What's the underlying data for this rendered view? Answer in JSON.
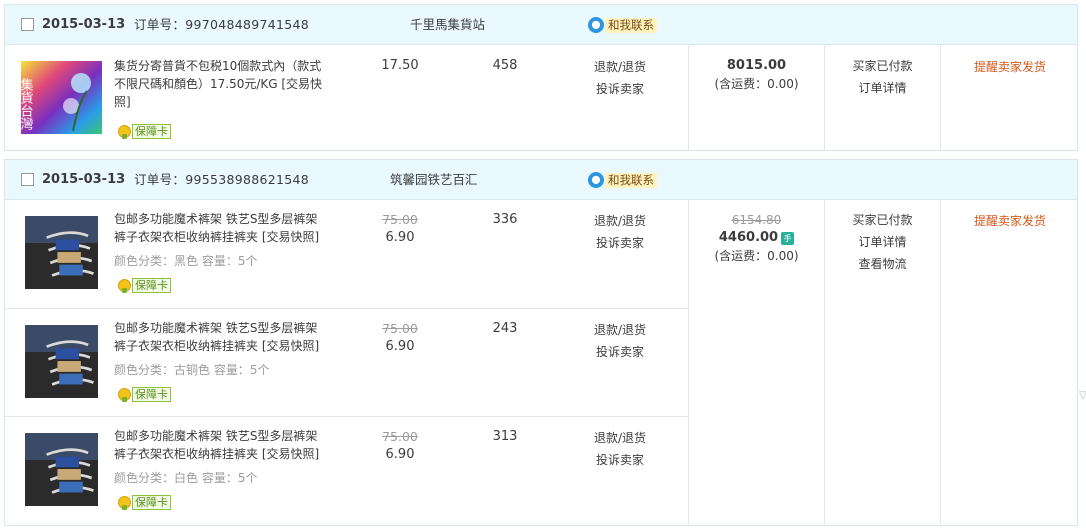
{
  "orders": [
    {
      "date": "2015-03-13",
      "order_no": "订单号：997048489741548",
      "shop": "千里馬集貨站",
      "contact_label": "和我联系",
      "items": [
        {
          "title": "集货分寄普貨不包税10個款式內（款式不限尺碼和顏色）17.50元/KG [交易快照]",
          "thumb_text": "集貨台灣",
          "card_label": "保障卡",
          "price": "17.50",
          "qty": "458",
          "actions": [
            "退款/退货",
            "投诉卖家"
          ]
        }
      ],
      "total": "8015.00",
      "shipping": "(含运费：0.00)",
      "status": [
        "买家已付款",
        "订单详情"
      ],
      "remind": "提醒卖家发货"
    },
    {
      "date": "2015-03-13",
      "order_no": "订单号：995538988621548",
      "shop": "筑馨园铁艺百汇",
      "contact_label": "和我联系",
      "items": [
        {
          "title": "包邮多功能魔术裤架 铁艺S型多层裤架裤子衣架衣柜收纳裤挂裤夹 [交易快照]",
          "sku": "颜色分类：黑色 容量：5个",
          "card_label": "保障卡",
          "orig_price": "75.00",
          "price": "6.90",
          "qty": "336",
          "actions": [
            "退款/退货",
            "投诉卖家"
          ]
        },
        {
          "title": "包邮多功能魔术裤架 铁艺S型多层裤架裤子衣架衣柜收纳裤挂裤夹 [交易快照]",
          "sku": "颜色分类：古铜色 容量：5个",
          "card_label": "保障卡",
          "orig_price": "75.00",
          "price": "6.90",
          "qty": "243",
          "actions": [
            "退款/退货",
            "投诉卖家"
          ]
        },
        {
          "title": "包邮多功能魔术裤架 铁艺S型多层裤架裤子衣架衣柜收纳裤挂裤夹 [交易快照]",
          "sku": "颜色分类：白色 容量：5个",
          "card_label": "保障卡",
          "orig_price": "75.00",
          "price": "6.90",
          "qty": "313",
          "actions": [
            "退款/退货",
            "投诉卖家"
          ]
        }
      ],
      "total_orig": "6154.80",
      "total": "4460.00",
      "mobile_badge": "手",
      "shipping": "(含运费：0.00)",
      "status": [
        "买家已付款",
        "订单详情",
        "查看物流"
      ],
      "remind": "提醒卖家发货"
    }
  ],
  "colors": {
    "header_bg": "#eaf8ff",
    "border": "#d8e6f0",
    "remind": "#d6581b",
    "contact_bg": "#fff4bf",
    "wangwang": "#2e96e0"
  },
  "icons": [
    "checkbox-icon",
    "wangwang-icon",
    "guarantee-card-icon",
    "mobile-order-icon"
  ]
}
